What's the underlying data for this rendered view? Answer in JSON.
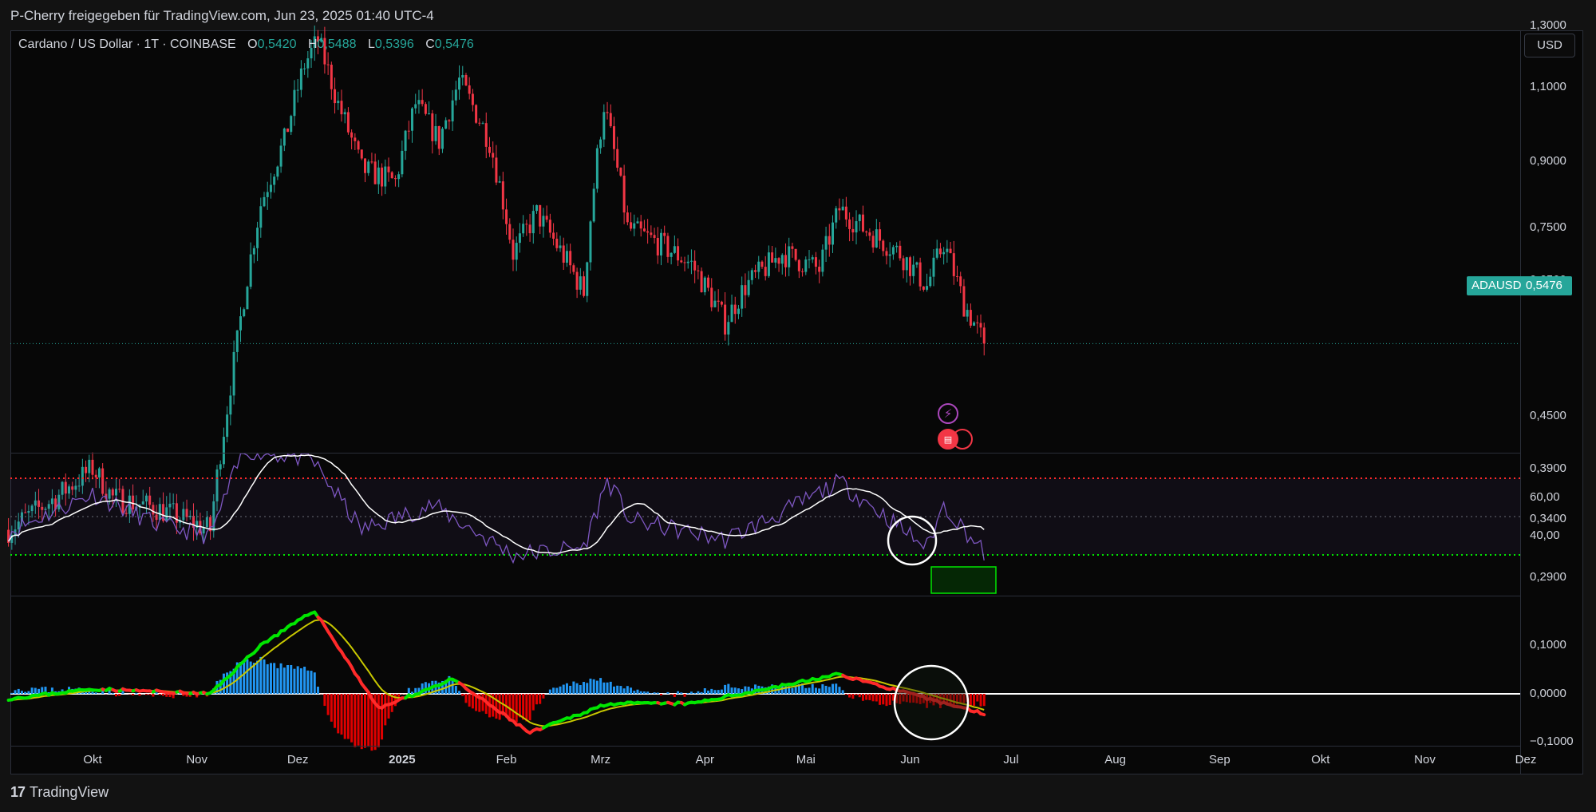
{
  "header": {
    "title": "P-Cherry freigegeben für TradingView.com, Jun 23, 2025 01:40 UTC-4"
  },
  "legend": {
    "symbol": "Cardano / US Dollar · 1T · COINBASE",
    "open_key": "O",
    "open": "0,5420",
    "high_key": "H",
    "high": "0,5488",
    "low_key": "L",
    "low": "0,5396",
    "close_key": "C",
    "close": "0,5476"
  },
  "toolbar": {
    "currency": "USD"
  },
  "price_axis": {
    "labels": [
      "1,3000",
      "1,1000",
      "0,9000",
      "0,7500",
      "0,6500",
      "0,4500",
      "0,3900",
      "0,3400",
      "0,2900"
    ]
  },
  "last_price": {
    "symbol": "ADAUSD",
    "value": "0,5476",
    "color": "#26a69a"
  },
  "rsi_axis": {
    "labels": [
      "60,00",
      "40,00"
    ]
  },
  "macd_axis": {
    "labels": [
      "0,1000",
      "0,0000",
      "−0,1000"
    ]
  },
  "time_axis": {
    "labels": [
      {
        "text": "Okt"
      },
      {
        "text": "Nov"
      },
      {
        "text": "Dez"
      },
      {
        "text": "2025",
        "bold": true
      },
      {
        "text": "Feb"
      },
      {
        "text": "Mrz"
      },
      {
        "text": "Apr"
      },
      {
        "text": "Mai"
      },
      {
        "text": "Jun"
      },
      {
        "text": "Jul"
      },
      {
        "text": "Aug"
      },
      {
        "text": "Sep"
      },
      {
        "text": "Okt"
      },
      {
        "text": "Nov"
      },
      {
        "text": "Dez"
      }
    ]
  },
  "events": [
    {
      "icon": "lightning-icon",
      "color": "#ab47bc"
    },
    {
      "icon": "us-flag-icon",
      "color": "#f23645"
    }
  ],
  "footer": {
    "brand": "TradingView"
  },
  "colors": {
    "up": "#26a69a",
    "down": "#f23645",
    "rsi": "#7e57c2",
    "rsi_ma": "#ffffff",
    "macd_up": "#00e600",
    "macd_down": "#ff2a2a",
    "signal": "#c8c800",
    "hist_up": "#2196f3",
    "hist_down": "#e00000"
  },
  "chart_data": {
    "type": "candlestick",
    "symbol": "ADAUSD",
    "y_scale": "log",
    "x_range": [
      "2024-09-01",
      "2025-12-31"
    ],
    "price_keypoints": [
      [
        "2024-09-06",
        0.33
      ],
      [
        "2024-09-20",
        0.36
      ],
      [
        "2024-10-01",
        0.39
      ],
      [
        "2024-10-07",
        0.36
      ],
      [
        "2024-10-20",
        0.35
      ],
      [
        "2024-11-05",
        0.33
      ],
      [
        "2024-11-10",
        0.46
      ],
      [
        "2024-11-13",
        0.55
      ],
      [
        "2024-11-20",
        0.8
      ],
      [
        "2024-11-27",
        0.95
      ],
      [
        "2024-12-03",
        1.17
      ],
      [
        "2024-12-07",
        1.25
      ],
      [
        "2024-12-13",
        1.05
      ],
      [
        "2024-12-20",
        0.88
      ],
      [
        "2024-12-30",
        0.85
      ],
      [
        "2025-01-05",
        1.05
      ],
      [
        "2025-01-12",
        0.95
      ],
      [
        "2025-01-18",
        1.12
      ],
      [
        "2025-01-27",
        0.95
      ],
      [
        "2025-02-03",
        0.7
      ],
      [
        "2025-02-10",
        0.78
      ],
      [
        "2025-02-24",
        0.63
      ],
      [
        "2025-03-02",
        1.05
      ],
      [
        "2025-03-09",
        0.75
      ],
      [
        "2025-03-18",
        0.72
      ],
      [
        "2025-03-28",
        0.68
      ],
      [
        "2025-04-07",
        0.58
      ],
      [
        "2025-04-13",
        0.64
      ],
      [
        "2025-04-24",
        0.7
      ],
      [
        "2025-05-05",
        0.67
      ],
      [
        "2025-05-11",
        0.79
      ],
      [
        "2025-05-18",
        0.75
      ],
      [
        "2025-05-29",
        0.7
      ],
      [
        "2025-06-06",
        0.64
      ],
      [
        "2025-06-11",
        0.72
      ],
      [
        "2025-06-17",
        0.61
      ],
      [
        "2025-06-23",
        0.5476
      ]
    ],
    "rsi_levels": {
      "upper": 70,
      "middle": 50,
      "lower": 30
    },
    "rsi_keypoints": [
      [
        "2024-09-06",
        42
      ],
      [
        "2024-10-01",
        62
      ],
      [
        "2024-10-20",
        46
      ],
      [
        "2024-11-05",
        40
      ],
      [
        "2024-11-15",
        85
      ],
      [
        "2024-12-05",
        80
      ],
      [
        "2024-12-20",
        43
      ],
      [
        "2025-01-10",
        56
      ],
      [
        "2025-02-03",
        30
      ],
      [
        "2025-02-24",
        34
      ],
      [
        "2025-03-03",
        69
      ],
      [
        "2025-03-10",
        48
      ],
      [
        "2025-04-07",
        38
      ],
      [
        "2025-04-24",
        52
      ],
      [
        "2025-05-11",
        68
      ],
      [
        "2025-06-06",
        34
      ],
      [
        "2025-06-11",
        56
      ],
      [
        "2025-06-23",
        31
      ]
    ],
    "macd_keypoints": [
      [
        "2024-09-06",
        -0.01
      ],
      [
        "2024-10-01",
        0.01
      ],
      [
        "2024-11-05",
        0.0
      ],
      [
        "2024-11-20",
        0.1
      ],
      [
        "2024-12-06",
        0.17
      ],
      [
        "2024-12-25",
        -0.03
      ],
      [
        "2025-01-16",
        0.03
      ],
      [
        "2025-02-08",
        -0.08
      ],
      [
        "2025-03-03",
        -0.02
      ],
      [
        "2025-03-28",
        -0.02
      ],
      [
        "2025-05-11",
        0.04
      ],
      [
        "2025-06-06",
        -0.01
      ],
      [
        "2025-06-23",
        -0.04
      ]
    ]
  }
}
